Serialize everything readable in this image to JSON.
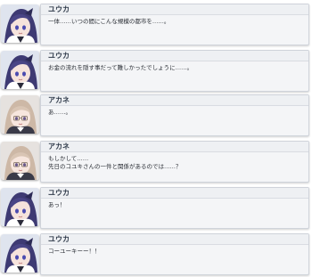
{
  "messages": [
    {
      "speaker": "ユウカ",
      "character": "yuuka",
      "text": "一体……いつの間にこんな規模の都市を……。"
    },
    {
      "speaker": "ユウカ",
      "character": "yuuka",
      "text": "お金の流れを隠す事だって難しかったでしょうに……。"
    },
    {
      "speaker": "アカネ",
      "character": "akane",
      "text": "あ……。"
    },
    {
      "speaker": "アカネ",
      "character": "akane",
      "text": "もしかして……\n先日のコユキさんの一件と関係があるのでは……？"
    },
    {
      "speaker": "ユウカ",
      "character": "yuuka",
      "text": "あっ！"
    },
    {
      "speaker": "ユウカ",
      "character": "yuuka",
      "text": "コーユーキーー！！"
    }
  ],
  "colors": {
    "card_bg": "#f4f5f7",
    "card_border": "#cfd3da",
    "name_text": "#2f3a4a",
    "message_text": "#2b2f36"
  }
}
